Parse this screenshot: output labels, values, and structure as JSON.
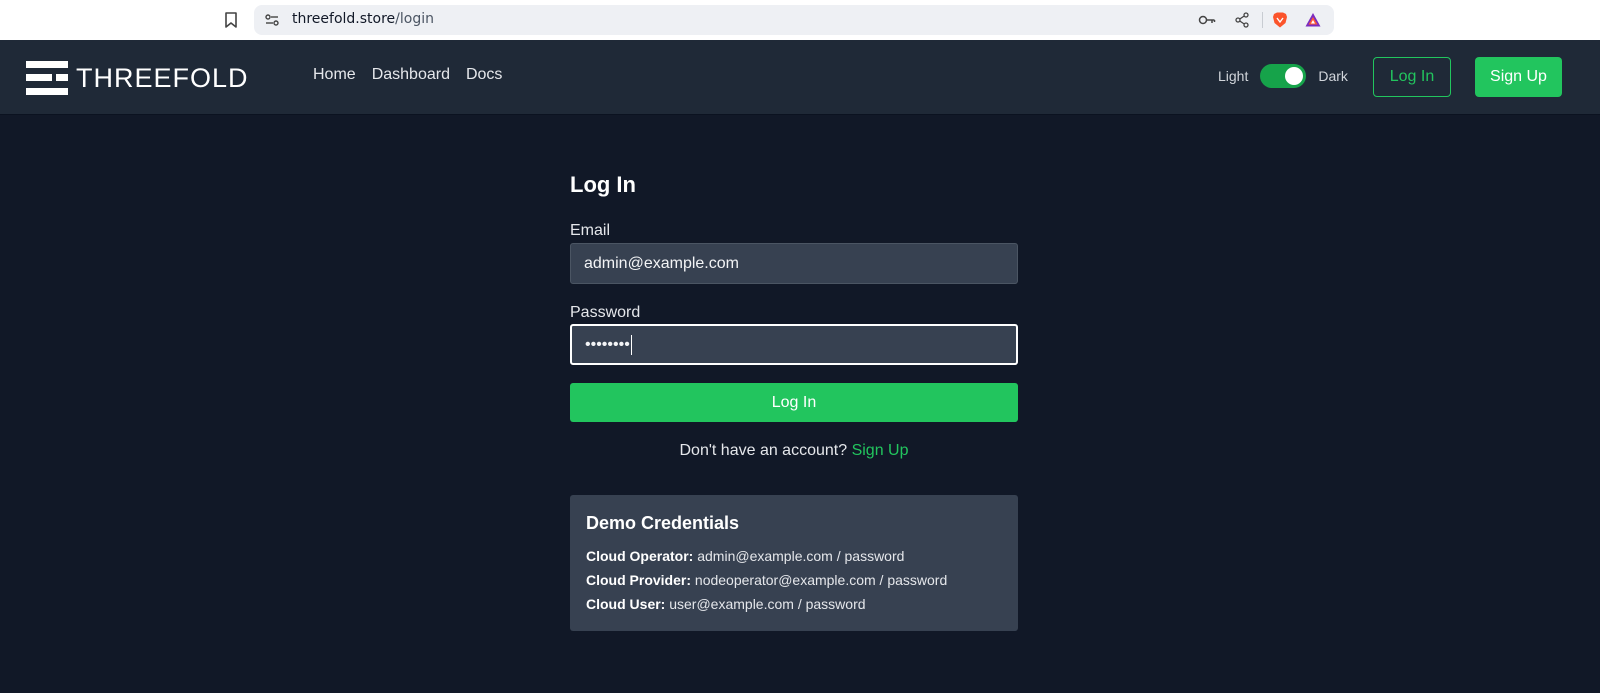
{
  "browser": {
    "url_host": "threefold.store",
    "url_path": "/login"
  },
  "header": {
    "logo_text": "THREEFOLD",
    "nav": [
      {
        "label": "Home"
      },
      {
        "label": "Dashboard"
      },
      {
        "label": "Docs"
      }
    ],
    "theme": {
      "light_label": "Light",
      "dark_label": "Dark",
      "dark_enabled": true
    },
    "login_label": "Log In",
    "signup_label": "Sign Up"
  },
  "login": {
    "title": "Log In",
    "email_label": "Email",
    "email_value": "admin@example.com",
    "password_label": "Password",
    "password_value": "••••••••",
    "submit_label": "Log In",
    "no_account_text": "Don't have an account?",
    "signup_link": "Sign Up"
  },
  "demo": {
    "title": "Demo Credentials",
    "items": [
      {
        "role": "Cloud Operator:",
        "value": "admin@example.com / password"
      },
      {
        "role": "Cloud Provider:",
        "value": "nodeoperator@example.com / password"
      },
      {
        "role": "Cloud User:",
        "value": "user@example.com / password"
      }
    ]
  },
  "colors": {
    "background": "#111827",
    "header": "#1f2937",
    "accent": "#22c55e",
    "input": "#374151"
  },
  "icons": [
    "bookmark-icon",
    "site-info-icon",
    "key-icon",
    "share-icon",
    "brave-icon",
    "rewards-icon",
    "logo-icon"
  ]
}
